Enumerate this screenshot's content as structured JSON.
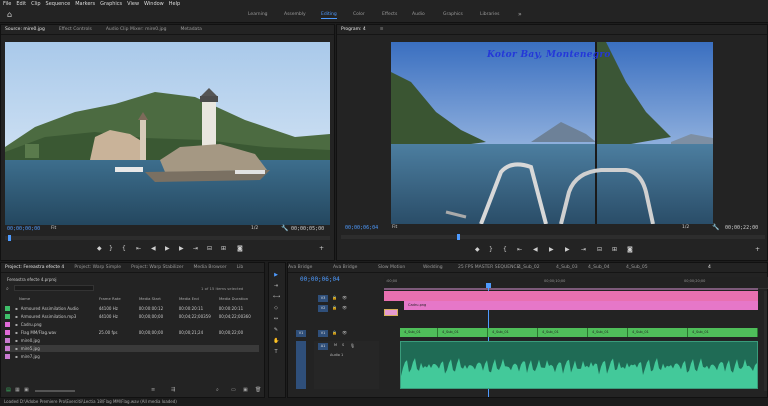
{
  "menu": [
    "File",
    "Edit",
    "Clip",
    "Sequence",
    "Markers",
    "Graphics",
    "View",
    "Window",
    "Help"
  ],
  "workspaces": [
    "Learning",
    "Assembly",
    "Editing",
    "Color",
    "Effects",
    "Audio",
    "Graphics",
    "Libraries"
  ],
  "active_workspace": "Editing",
  "ws_more": "»",
  "source": {
    "tabs": [
      "Source: mire0.jpg",
      "Effect Controls",
      "Audio Clip Mixer: mire0.jpg",
      "Metadata"
    ],
    "timecode": "00;00;00;00",
    "fit": "Fit",
    "duration": "00;00;05;00",
    "ratio": "1/2"
  },
  "program": {
    "tab": "Program: 4",
    "overlay_title": "Kotor Bay, Montenegro",
    "timecode": "00;00;06;04",
    "fit": "Fit",
    "duration": "00;00;22;00",
    "ratio": "1/2"
  },
  "project": {
    "tabs": [
      "Project: Fereastra efecte 4",
      "Project: Warp Simple",
      "Project: Warp Stabilizer",
      "Media Browser",
      "Lib"
    ],
    "file": "Fereastra efecte 4.prproj",
    "items_selected": "1 of 15 items selected",
    "columns": [
      "Name",
      "Frame Rate",
      "Media Start",
      "Media End",
      "Media Duration"
    ],
    "rows": [
      {
        "name": "Armoured Assimilation Audio",
        "fps": "44100 Hz",
        "start": "00:00:00:12",
        "end": "00:00:20:11",
        "dur": "00:00:20:11",
        "color": "#3fbf6a"
      },
      {
        "name": "Armoured Assimilation.mp3",
        "fps": "44100 Hz",
        "start": "00;00;00;00",
        "end": "00;04;22;00359",
        "dur": "00;04;22;00360",
        "color": "#3fbf6a"
      },
      {
        "name": "Cadru.png",
        "fps": "",
        "start": "",
        "end": "",
        "dur": "",
        "color": "#e06ad8"
      },
      {
        "name": "Flag MM/Flag.wav",
        "fps": "25.00 fps",
        "start": "00;00;00;00",
        "end": "00;00;21;24",
        "dur": "00;00;22;00",
        "color": "#e06ad8"
      },
      {
        "name": "mire0.jpg",
        "fps": "",
        "start": "",
        "end": "",
        "dur": "",
        "color": "#c87ad0"
      },
      {
        "name": "mire5.jpg",
        "fps": "",
        "start": "",
        "end": "",
        "dur": "",
        "color": "#c87ad0"
      },
      {
        "name": "mire7.jpg",
        "fps": "",
        "start": "",
        "end": "",
        "dur": "",
        "color": "#c87ad0"
      }
    ]
  },
  "timeline": {
    "tabs": [
      "Ava Bridge",
      "Ava Bridge",
      "Slow Motion",
      "Wedding",
      "25 FPS MASTER SEQUENCE",
      "4_Sub_02",
      "4_Sub_03",
      "4_Sub_04",
      "4_Sub_05",
      "4"
    ],
    "timecode": "00;00;06;04",
    "ruler": [
      ":00;00",
      "00;00;10;00",
      "00;00;20;00"
    ],
    "video_tracks": [
      "V3",
      "V2",
      "V1"
    ],
    "audio_tracks": [
      "A1",
      "A2"
    ],
    "clip_pink": "Cadru.png",
    "clip_green": [
      "4_Sub_01",
      "4_Sub_01",
      "4_Sub_01",
      "4_Sub_01",
      "4_Sub_01",
      "4_Sub_01",
      "4_Sub_01"
    ],
    "audio_label": "Audio 1"
  },
  "status": "Loaded D:\\Adobe Premiere Pro\\Exercitii\\Lectia 18\\Flag MM\\Flag.wav (All media loaded)"
}
